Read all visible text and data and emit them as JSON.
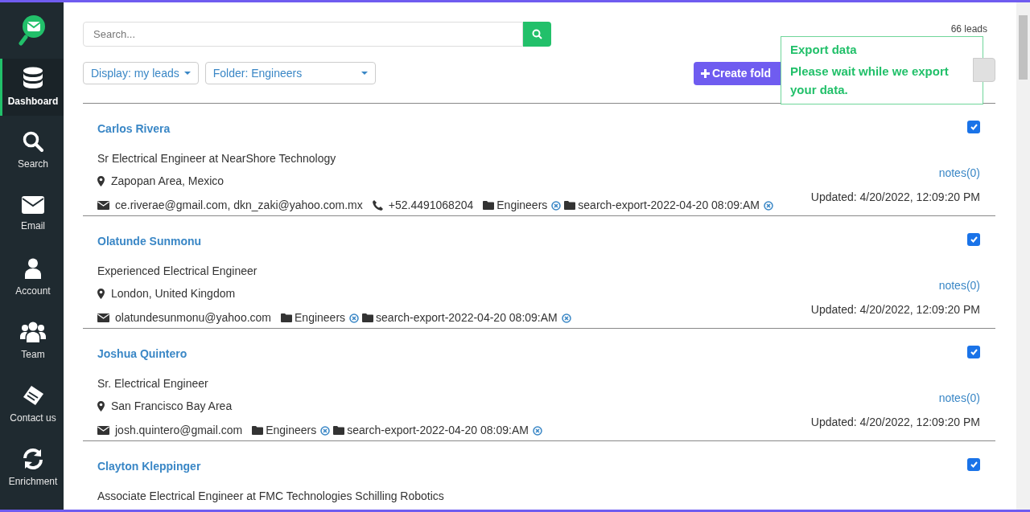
{
  "sidebar": {
    "items": [
      {
        "kind": "dashboard",
        "label": "Dashboard",
        "selected": true
      },
      {
        "kind": "search",
        "label": "Search",
        "selected": false
      },
      {
        "kind": "email",
        "label": "Email",
        "selected": false
      },
      {
        "kind": "account",
        "label": "Account",
        "selected": false
      },
      {
        "kind": "team",
        "label": "Team",
        "selected": false
      },
      {
        "kind": "contact",
        "label": "Contact us",
        "selected": false
      },
      {
        "kind": "enrichment",
        "label": "Enrichment",
        "selected": false
      }
    ]
  },
  "search": {
    "placeholder": "Search..."
  },
  "filters": {
    "display": "Display: my leads",
    "folder": "Folder: Engineers"
  },
  "create_folder_button": "Create fold",
  "lead_count": "66 leads",
  "toast": {
    "title": "Export data",
    "message": "Please wait while we export your data."
  },
  "leads": [
    {
      "name": "Carlos Rivera",
      "title": "Sr Electrical Engineer at NearShore Technology",
      "location": "Zapopan Area, Mexico",
      "contacts": [
        {
          "kind": "email",
          "text": "ce.riverae@gmail.com, dkn_zaki@yahoo.com.mx"
        },
        {
          "kind": "phone",
          "text": "+52.4491068204"
        }
      ],
      "folders": [
        "Engineers",
        "search-export-2022-04-20 08:09:AM"
      ],
      "notes": "notes(0)",
      "updated": "Updated: 4/20/2022, 12:09:20 PM",
      "checked": true
    },
    {
      "name": "Olatunde Sunmonu",
      "title": "Experienced Electrical Engineer",
      "location": "London, United Kingdom",
      "contacts": [
        {
          "kind": "email",
          "text": "olatundesunmonu@yahoo.com"
        }
      ],
      "folders": [
        "Engineers",
        "search-export-2022-04-20 08:09:AM"
      ],
      "notes": "notes(0)",
      "updated": "Updated: 4/20/2022, 12:09:20 PM",
      "checked": true
    },
    {
      "name": "Joshua Quintero",
      "title": "Sr. Electrical Engineer",
      "location": "San Francisco Bay Area",
      "contacts": [
        {
          "kind": "email",
          "text": "josh.quintero@gmail.com"
        }
      ],
      "folders": [
        "Engineers",
        "search-export-2022-04-20 08:09:AM"
      ],
      "notes": "notes(0)",
      "updated": "Updated: 4/20/2022, 12:09:20 PM",
      "checked": true
    },
    {
      "name": "Clayton Kleppinger",
      "title": "Associate Electrical Engineer at FMC Technologies Schilling Robotics",
      "checked": true
    }
  ]
}
